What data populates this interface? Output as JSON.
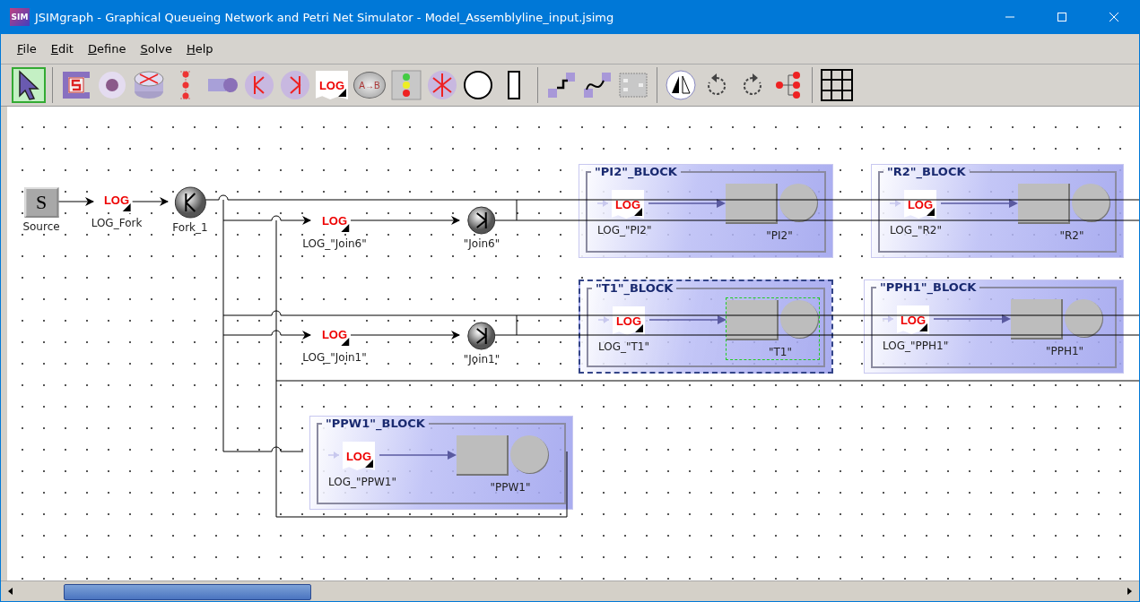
{
  "window": {
    "app_icon": "SIM",
    "title": "JSIMgraph - Graphical Queueing Network and Petri Net Simulator - Model_Assemblyline_input.jsimg"
  },
  "menu": [
    "File",
    "Edit",
    "Define",
    "Solve",
    "Help"
  ],
  "toolbar": [
    {
      "kind": "pointer",
      "selected": true
    },
    {
      "kind": "source",
      "selected": false
    },
    {
      "kind": "delay",
      "selected": false
    },
    {
      "kind": "server",
      "selected": false
    },
    {
      "kind": "petri",
      "selected": false
    },
    {
      "kind": "queue",
      "selected": false
    },
    {
      "kind": "fork",
      "selected": false
    },
    {
      "kind": "join",
      "selected": false
    },
    {
      "kind": "log",
      "text": "LOG",
      "selected": false
    },
    {
      "kind": "switch",
      "text": "A→B",
      "selected": false
    },
    {
      "kind": "traffic",
      "selected": false
    },
    {
      "kind": "router",
      "selected": false
    },
    {
      "kind": "place",
      "selected": false
    },
    {
      "kind": "transition",
      "selected": false
    },
    {
      "kind": "connector",
      "selected": false
    },
    {
      "kind": "curve",
      "selected": false
    },
    {
      "kind": "block",
      "selected": false
    },
    {
      "kind": "mirror",
      "selected": false
    },
    {
      "kind": "rotate_left",
      "selected": false
    },
    {
      "kind": "rotate_right",
      "selected": false
    },
    {
      "kind": "tree",
      "selected": false
    },
    {
      "kind": "grid",
      "selected": false
    }
  ],
  "nodes": [
    {
      "kind": "source",
      "symbol": "S",
      "label": "Source"
    },
    {
      "kind": "log",
      "badge": "LOG",
      "label": "LOG_Fork"
    },
    {
      "kind": "fork",
      "label": "Fork_1"
    },
    {
      "kind": "log",
      "badge": "LOG",
      "label": "LOG_\"Join6\""
    },
    {
      "kind": "join",
      "label": "\"Join6\""
    },
    {
      "kind": "log",
      "badge": "LOG",
      "label": "LOG_\"Join1\""
    },
    {
      "kind": "join",
      "label": "\"Join1\""
    }
  ],
  "blocks": [
    {
      "title": "\"PI2\"_BLOCK",
      "log_badge": "LOG",
      "log_label": "LOG_\"PI2\"",
      "server_label": "\"PI2\"",
      "selected": false,
      "server_selected": false
    },
    {
      "title": "\"R2\"_BLOCK",
      "log_badge": "LOG",
      "log_label": "LOG_\"R2\"",
      "server_label": "\"R2\"",
      "selected": false,
      "server_selected": false
    },
    {
      "title": "\"T1\"_BLOCK",
      "log_badge": "LOG",
      "log_label": "LOG_\"T1\"",
      "server_label": "\"T1\"",
      "selected": true,
      "server_selected": true
    },
    {
      "title": "\"PPH1\"_BLOCK",
      "log_badge": "LOG",
      "log_label": "LOG_\"PPH1\"",
      "server_label": "\"PPH1\"",
      "selected": false,
      "server_selected": false
    },
    {
      "title": "\"PPW1\"_BLOCK",
      "log_badge": "LOG",
      "log_label": "LOG_\"PPW1\"",
      "server_label": "\"PPW1\"",
      "selected": false,
      "server_selected": false
    }
  ]
}
